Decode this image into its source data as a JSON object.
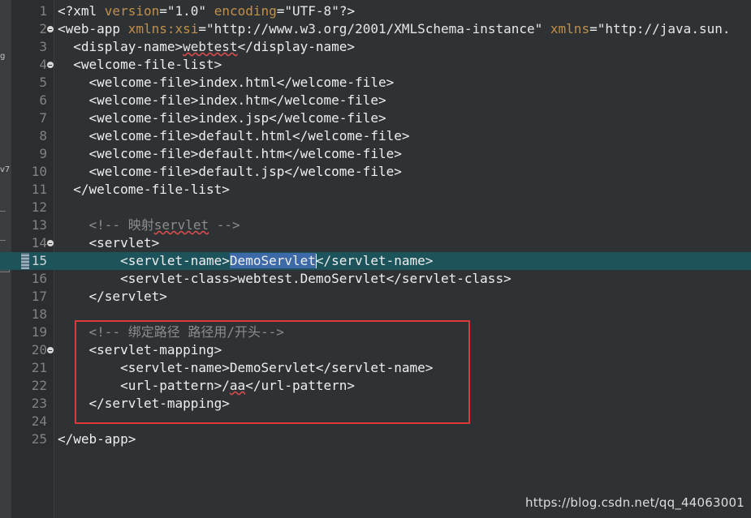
{
  "editor": {
    "current_line": 15,
    "lines": [
      {
        "n": "1",
        "segs": [
          [
            "tag",
            "<?xml "
          ],
          [
            "attr",
            "version"
          ],
          [
            "tag",
            "="
          ],
          [
            "str",
            "\"1.0\""
          ],
          [
            "tag",
            " "
          ],
          [
            "attr",
            "encoding"
          ],
          [
            "tag",
            "="
          ],
          [
            "str",
            "\"UTF-8\""
          ],
          [
            "tag",
            "?>"
          ]
        ]
      },
      {
        "n": "2",
        "segs": [
          [
            "tag",
            "<web-app "
          ],
          [
            "attr",
            "xmlns:xsi"
          ],
          [
            "tag",
            "="
          ],
          [
            "str",
            "\"http://www.w3.org/2001/XMLSchema-instance\""
          ],
          [
            "tag",
            " "
          ],
          [
            "attr",
            "xmlns"
          ],
          [
            "tag",
            "="
          ],
          [
            "str",
            "\"http://java.sun."
          ]
        ]
      },
      {
        "n": "3",
        "segs": [
          [
            "tag",
            "  <display-name>"
          ],
          [
            "squig",
            "webtest"
          ],
          [
            "tag",
            "</display-name>"
          ]
        ]
      },
      {
        "n": "4",
        "segs": [
          [
            "tag",
            "  <welcome-file-list>"
          ]
        ]
      },
      {
        "n": "5",
        "segs": [
          [
            "tag",
            "    <welcome-file>index.html</welcome-file>"
          ]
        ]
      },
      {
        "n": "6",
        "segs": [
          [
            "tag",
            "    <welcome-file>index.htm</welcome-file>"
          ]
        ]
      },
      {
        "n": "7",
        "segs": [
          [
            "tag",
            "    <welcome-file>index.jsp</welcome-file>"
          ]
        ]
      },
      {
        "n": "8",
        "segs": [
          [
            "tag",
            "    <welcome-file>default.html</welcome-file>"
          ]
        ]
      },
      {
        "n": "9",
        "segs": [
          [
            "tag",
            "    <welcome-file>default.htm</welcome-file>"
          ]
        ]
      },
      {
        "n": "10",
        "segs": [
          [
            "tag",
            "    <welcome-file>default.jsp</welcome-file>"
          ]
        ]
      },
      {
        "n": "11",
        "segs": [
          [
            "tag",
            "  </welcome-file-list>"
          ]
        ]
      },
      {
        "n": "12",
        "segs": []
      },
      {
        "n": "13",
        "segs": [
          [
            "cmt",
            "    <!-- 映射"
          ],
          [
            "cmt squig",
            "servlet"
          ],
          [
            "cmt",
            " -->"
          ]
        ]
      },
      {
        "n": "14",
        "segs": [
          [
            "tag",
            "    <servlet>"
          ]
        ]
      },
      {
        "n": "15",
        "segs": [
          [
            "tag",
            "        <servlet-name>"
          ],
          [
            "tag sel",
            "DemoServlet"
          ],
          [
            "tag",
            "</servlet-name>"
          ]
        ]
      },
      {
        "n": "16",
        "segs": [
          [
            "tag",
            "        <servlet-class>webtest.DemoServlet</servlet-class>"
          ]
        ]
      },
      {
        "n": "17",
        "segs": [
          [
            "tag",
            "    </servlet>"
          ]
        ]
      },
      {
        "n": "18",
        "segs": []
      },
      {
        "n": "19",
        "segs": [
          [
            "cmt",
            "    <!-- 绑定路径 路径用/开头-->"
          ]
        ]
      },
      {
        "n": "20",
        "segs": [
          [
            "tag",
            "    <servlet-mapping>"
          ]
        ]
      },
      {
        "n": "21",
        "segs": [
          [
            "tag",
            "        <servlet-name>DemoServlet</servlet-name>"
          ]
        ]
      },
      {
        "n": "22",
        "segs": [
          [
            "tag",
            "        <url-pattern>/"
          ],
          [
            "tag squig",
            "aa"
          ],
          [
            "tag",
            "</url-pattern>"
          ]
        ]
      },
      {
        "n": "23",
        "segs": [
          [
            "tag",
            "    </servlet-mapping>"
          ]
        ]
      },
      {
        "n": "24",
        "segs": []
      },
      {
        "n": "25",
        "segs": [
          [
            "tag",
            "</web-app>"
          ]
        ]
      }
    ],
    "fold_lines": [
      "2",
      "4",
      "14",
      "20"
    ]
  },
  "left_panel": {
    "fragment_1": "g",
    "fragment_2": "v7"
  },
  "watermark": "https://blog.csdn.net/qq_44063001"
}
